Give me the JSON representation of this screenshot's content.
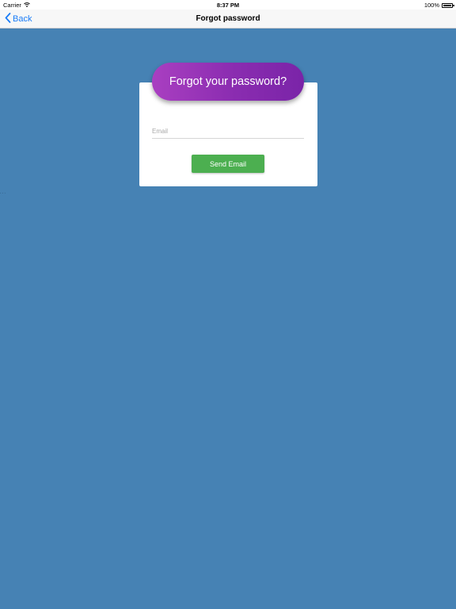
{
  "status_bar": {
    "carrier": "Carrier",
    "time": "8:37 PM",
    "battery": "100%",
    "battery_level": 1.0
  },
  "nav": {
    "back_label": "Back",
    "title": "Forgot password"
  },
  "form": {
    "heading": "Forgot your password?",
    "email_placeholder": "Email",
    "email_value": "",
    "submit_label": "Send Email"
  },
  "colors": {
    "background": "#4682b4",
    "accent_purple": "#8a2cb0",
    "button_green": "#4caf50",
    "link_blue": "#1a7cf7"
  }
}
